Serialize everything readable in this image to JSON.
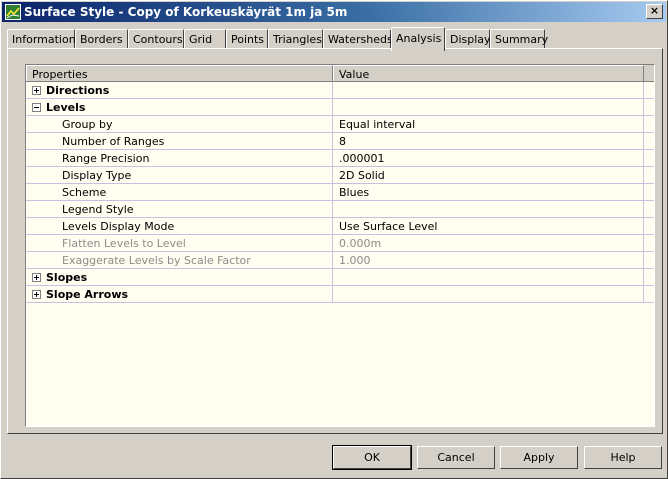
{
  "window": {
    "title": "Surface Style - Copy of Korkeuskäyrät 1m ja 5m",
    "close_label": "×"
  },
  "tabs": [
    {
      "label": "Information"
    },
    {
      "label": "Borders"
    },
    {
      "label": "Contours"
    },
    {
      "label": "Grid"
    },
    {
      "label": "Points"
    },
    {
      "label": "Triangles"
    },
    {
      "label": "Watersheds"
    },
    {
      "label": "Analysis",
      "active": true
    },
    {
      "label": "Display"
    },
    {
      "label": "Summary"
    }
  ],
  "grid": {
    "header": {
      "property": "Properties",
      "value": "Value"
    },
    "rows": [
      {
        "label": "Directions",
        "value": "",
        "expanded": false
      },
      {
        "label": "Levels",
        "value": "",
        "expanded": true
      },
      {
        "label": "Group by",
        "value": "Equal interval"
      },
      {
        "label": "Number of Ranges",
        "value": "8"
      },
      {
        "label": "Range Precision",
        "value": ".000001"
      },
      {
        "label": "Display Type",
        "value": "2D Solid"
      },
      {
        "label": "Scheme",
        "value": "Blues"
      },
      {
        "label": "Legend Style",
        "value": ""
      },
      {
        "label": "Levels Display Mode",
        "value": "Use Surface Level"
      },
      {
        "label": "Flatten Levels to Level",
        "value": "0.000m",
        "disabled": true
      },
      {
        "label": "Exaggerate Levels by Scale Factor",
        "value": "1.000",
        "disabled": true
      },
      {
        "label": "Slopes",
        "value": "",
        "expanded": false
      },
      {
        "label": "Slope Arrows",
        "value": "",
        "expanded": false
      }
    ]
  },
  "buttons": {
    "ok": "OK",
    "cancel": "Cancel",
    "apply": "Apply",
    "help": "Help"
  }
}
